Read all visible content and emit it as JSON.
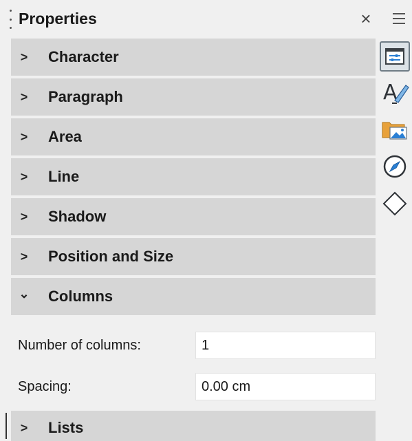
{
  "panel": {
    "title": "Properties",
    "close_glyph": "×",
    "menu_icon": "hamburger-menu-icon"
  },
  "sections": [
    {
      "label": "Character",
      "expanded": false,
      "chevron": ">"
    },
    {
      "label": "Paragraph",
      "expanded": false,
      "chevron": ">"
    },
    {
      "label": "Area",
      "expanded": false,
      "chevron": ">"
    },
    {
      "label": "Line",
      "expanded": false,
      "chevron": ">"
    },
    {
      "label": "Shadow",
      "expanded": false,
      "chevron": ">"
    },
    {
      "label": "Position and Size",
      "expanded": false,
      "chevron": ">"
    },
    {
      "label": "Columns",
      "expanded": true,
      "chevron": "⌄"
    }
  ],
  "columns": {
    "number_label": "Number of columns:",
    "number_value": "1",
    "spacing_label": "Spacing:",
    "spacing_value": "0.00 cm"
  },
  "lists": {
    "label": "Lists",
    "chevron": ">"
  },
  "tabbar": [
    {
      "icon": "properties-icon",
      "active": true
    },
    {
      "icon": "styles-icon",
      "active": false
    },
    {
      "icon": "gallery-icon",
      "active": false
    },
    {
      "icon": "navigator-icon",
      "active": false
    },
    {
      "icon": "shapes-icon",
      "active": false
    }
  ],
  "colors": {
    "panel_bg": "#f0f0f0",
    "section_bg": "#d6d6d6",
    "accent_blue": "#2a7fd4",
    "folder_orange": "#e8a13a"
  }
}
